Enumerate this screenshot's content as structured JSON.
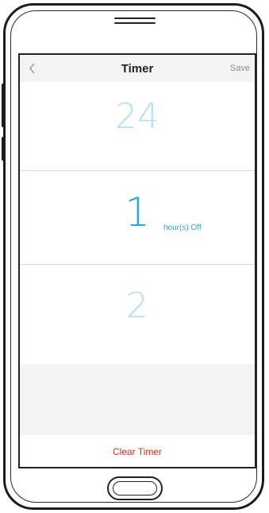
{
  "header": {
    "back_icon": "chevron-left-icon",
    "title": "Timer",
    "save_label": "Save"
  },
  "picker": {
    "previous_value": "24",
    "selected_value": "1",
    "next_value": "2",
    "unit_label": "hour(s) Off"
  },
  "footer": {
    "clear_label": "Clear Timer"
  },
  "colors": {
    "accent": "#23a8ee",
    "faded_accent": "#b6e0f7",
    "danger": "#f0271b",
    "header_bg": "#f3f3f3"
  }
}
